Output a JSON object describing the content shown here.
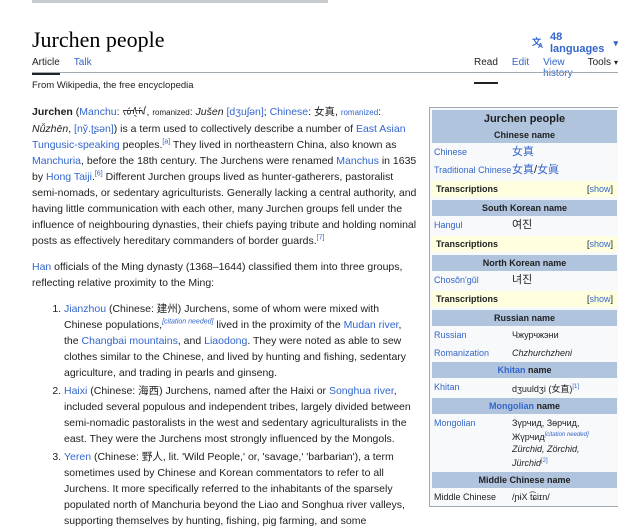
{
  "page": {
    "title": "Jurchen people",
    "languages": "48 languages",
    "tabs_left": [
      "Article",
      "Talk"
    ],
    "tabs_right": [
      "Read",
      "Edit",
      "View history",
      "Tools"
    ],
    "from": "From Wikipedia, the free encyclopedia"
  },
  "article": {
    "p1": {
      "name": "Jurchen",
      "manchu": "Manchu",
      "manchu_script": "ᠵᡠᡧᡝᠨ",
      "romanized1": "romanized",
      "jusen": "Jušen",
      "jusen_ipa": "[dʒuʃən]",
      "chinese": "Chinese",
      "chinese_val": "女真",
      "romanized2": "romanized",
      "nuzhen": "Nǚzhēn",
      "nuzhen_ipa": "[ny̌.ʈʂən]",
      "t1": ") is a term used to collectively describe a number of ",
      "tungusic": "East Asian Tungusic-speaking",
      "t2": " peoples.",
      "ref_a": "[a]",
      "t3": " They lived in northeastern China, also known as ",
      "manchuria": "Manchuria",
      "t4": ", before the 18th century. The Jurchens were renamed ",
      "manchus": "Manchus",
      "t5": " in 1635 by ",
      "hong": "Hong Taiji",
      "ref_6": "[6]",
      "t6": " Different Jurchen groups lived as hunter-gatherers, pastoralist semi-nomads, or sedentary agriculturists. Generally lacking a central authority, and having little communication with each other, many Jurchen groups fell under the influence of neighbouring dynasties, their chiefs paying tribute and holding nominal posts as effectively hereditary commanders of border guards.",
      "ref_7": "[7]"
    },
    "p2": {
      "han": "Han",
      "text": " officials of the Ming dynasty (1368–1644) classified them into three groups, reflecting relative proximity to the Ming:"
    },
    "li1": {
      "link": "Jianzhou",
      "t1": " (Chinese: 建州) Jurchens, some of whom were mixed with Chinese populations,",
      "cn": "[citation needed]",
      "t2": " lived in the proximity of the ",
      "mudan": "Mudan river",
      "t3": ", the ",
      "changbai": "Changbai mountains",
      "t4": ", and ",
      "liaodong": "Liaodong",
      "t5": ". They were noted as able to sew clothes similar to the Chinese, and lived by hunting and fishing, sedentary agriculture, and trading in pearls and ginseng."
    },
    "li2": {
      "link": "Haixi",
      "t1": " (Chinese: 海西) Jurchens, named after the Haixi or ",
      "songhua": "Songhua river",
      "t2": ", included several populous and independent tribes, largely divided between semi-nomadic pastoralists in the west and sedentary agriculturalists in the east. They were the Jurchens most strongly influenced by the Mongols."
    },
    "li3": {
      "link": "Yeren",
      "t1": " (Chinese: 野人, lit. 'Wild People,' or, 'savage,' 'barbarian'), a term sometimes used by Chinese and Korean commentators to refer to all Jurchens. It more specifically referred to the inhabitants of the sparsely populated north of Manchuria beyond the Liao and Songhua river valleys, supporting themselves by hunting, fishing, pig farming, and some"
    }
  },
  "infobox": {
    "title": "Jurchen people",
    "chinese_name": "Chinese name",
    "chinese_k": "Chinese",
    "chinese_v": "女真",
    "trad_k": "Traditional Chinese",
    "trad_v1": "女真",
    "trad_sep": "/",
    "trad_v2": "女眞",
    "transcriptions": "Transcriptions",
    "show_open": "[",
    "show": "show",
    "show_close": "]",
    "south_korean": "South Korean name",
    "hangul_k": "Hangul",
    "hangul_v": "여진",
    "north_korean": "North Korean name",
    "chosongul_k": "Chosŏn'gŭl",
    "chosongul_v": "녀진",
    "russian_name": "Russian name",
    "russian_k": "Russian",
    "russian_v": "Чжурчжэни",
    "romanization_k": "Romanization",
    "romanization_v": "Chzhurchzheni",
    "khitan_link": "Khitan",
    "khitan_name": " name",
    "khitan_k": "Khitan",
    "khitan_v": "dʒuuldʒi (女直)",
    "khitan_ref": "[1]",
    "mongolian_link": "Mongolian",
    "mongolian_name": " name",
    "mongolian_k": "Mongolian",
    "mongolian_v1": "Зүрчид, Зөрчид, Жүрчид",
    "mongolian_cn": "[citation needed]",
    "mongolian_v2": "Zürchid, Zörchid, Jürchid",
    "mongolian_ref": "[2]",
    "middle_chinese": "Middle Chinese name",
    "mc_k": "Middle Chinese",
    "mc_v": "/ɲɨX t͡ɕiɪn/"
  }
}
